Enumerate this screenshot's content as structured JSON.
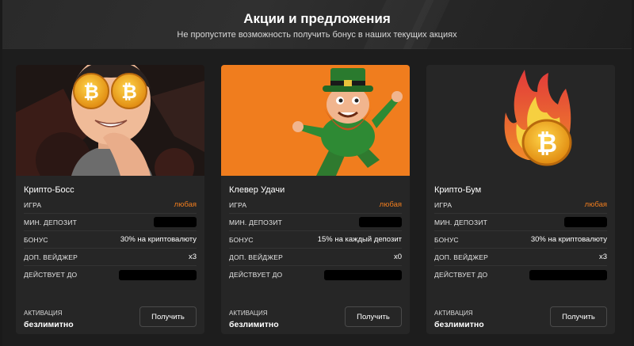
{
  "header": {
    "title": "Акции и предложения",
    "subtitle": "Не пропустите возможность получить бонус в наших текущих акциях"
  },
  "labels": {
    "game": "ИГРА",
    "min_deposit": "МИН. ДЕПОЗИТ",
    "bonus": "БОНУС",
    "wager": "ДОП. ВЕЙДЖЕР",
    "valid_until": "ДЕЙСТВУЕТ ДО",
    "activation": "АКТИВАЦИЯ"
  },
  "cards": [
    {
      "title": "Крипто-Босс",
      "game": "любая",
      "bonus": "30% на криптовалюту",
      "wager": "x3",
      "activation": "безлимитно",
      "button": "Получить",
      "image": "crypto-boss-avatar"
    },
    {
      "title": "Клевер Удачи",
      "game": "любая",
      "bonus": "15% на каждый депозит",
      "wager": "x0",
      "activation": "безлимитно",
      "button": "Получить",
      "image": "leprechaun"
    },
    {
      "title": "Крипто-Бум",
      "game": "любая",
      "bonus": "30% на криптовалюту",
      "wager": "x3",
      "activation": "безлимитно",
      "button": "Получить",
      "image": "flaming-bitcoin"
    }
  ],
  "colors": {
    "accent": "#f07d1e",
    "card_bg": "#262626",
    "page_bg": "#1d1d1d"
  }
}
